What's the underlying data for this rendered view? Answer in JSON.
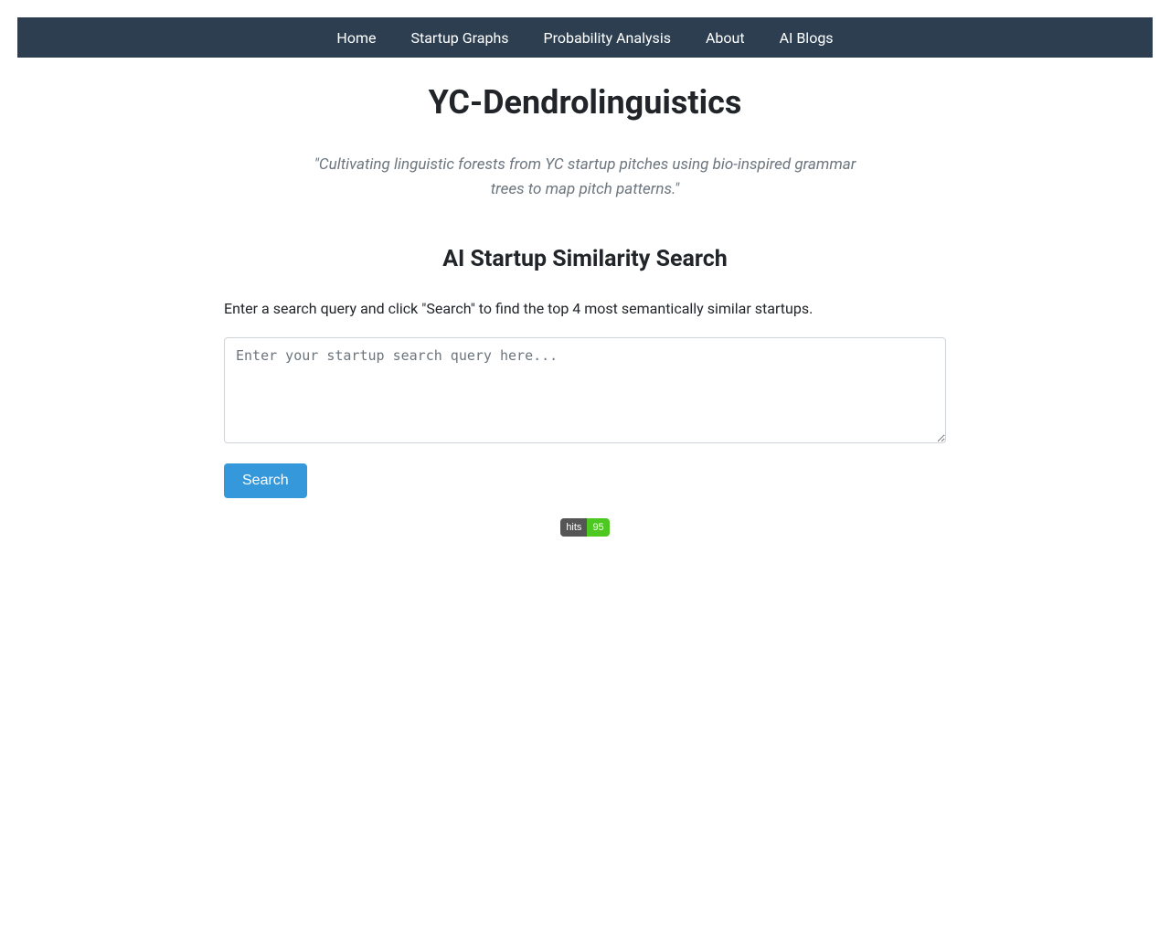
{
  "nav": {
    "items": [
      {
        "label": "Home"
      },
      {
        "label": "Startup Graphs"
      },
      {
        "label": "Probability Analysis"
      },
      {
        "label": "About"
      },
      {
        "label": "AI Blogs"
      }
    ]
  },
  "header": {
    "title": "YC-Dendrolinguistics",
    "tagline": "\"Cultivating linguistic forests from YC startup pitches using bio-inspired grammar trees to map pitch patterns.\""
  },
  "search": {
    "section_title": "AI Startup Similarity Search",
    "instruction": "Enter a search query and click \"Search\" to find the top 4 most semantically similar startups.",
    "placeholder": "Enter your startup search query here...",
    "button_label": "Search"
  },
  "counter": {
    "label": "hits",
    "value": "95"
  }
}
